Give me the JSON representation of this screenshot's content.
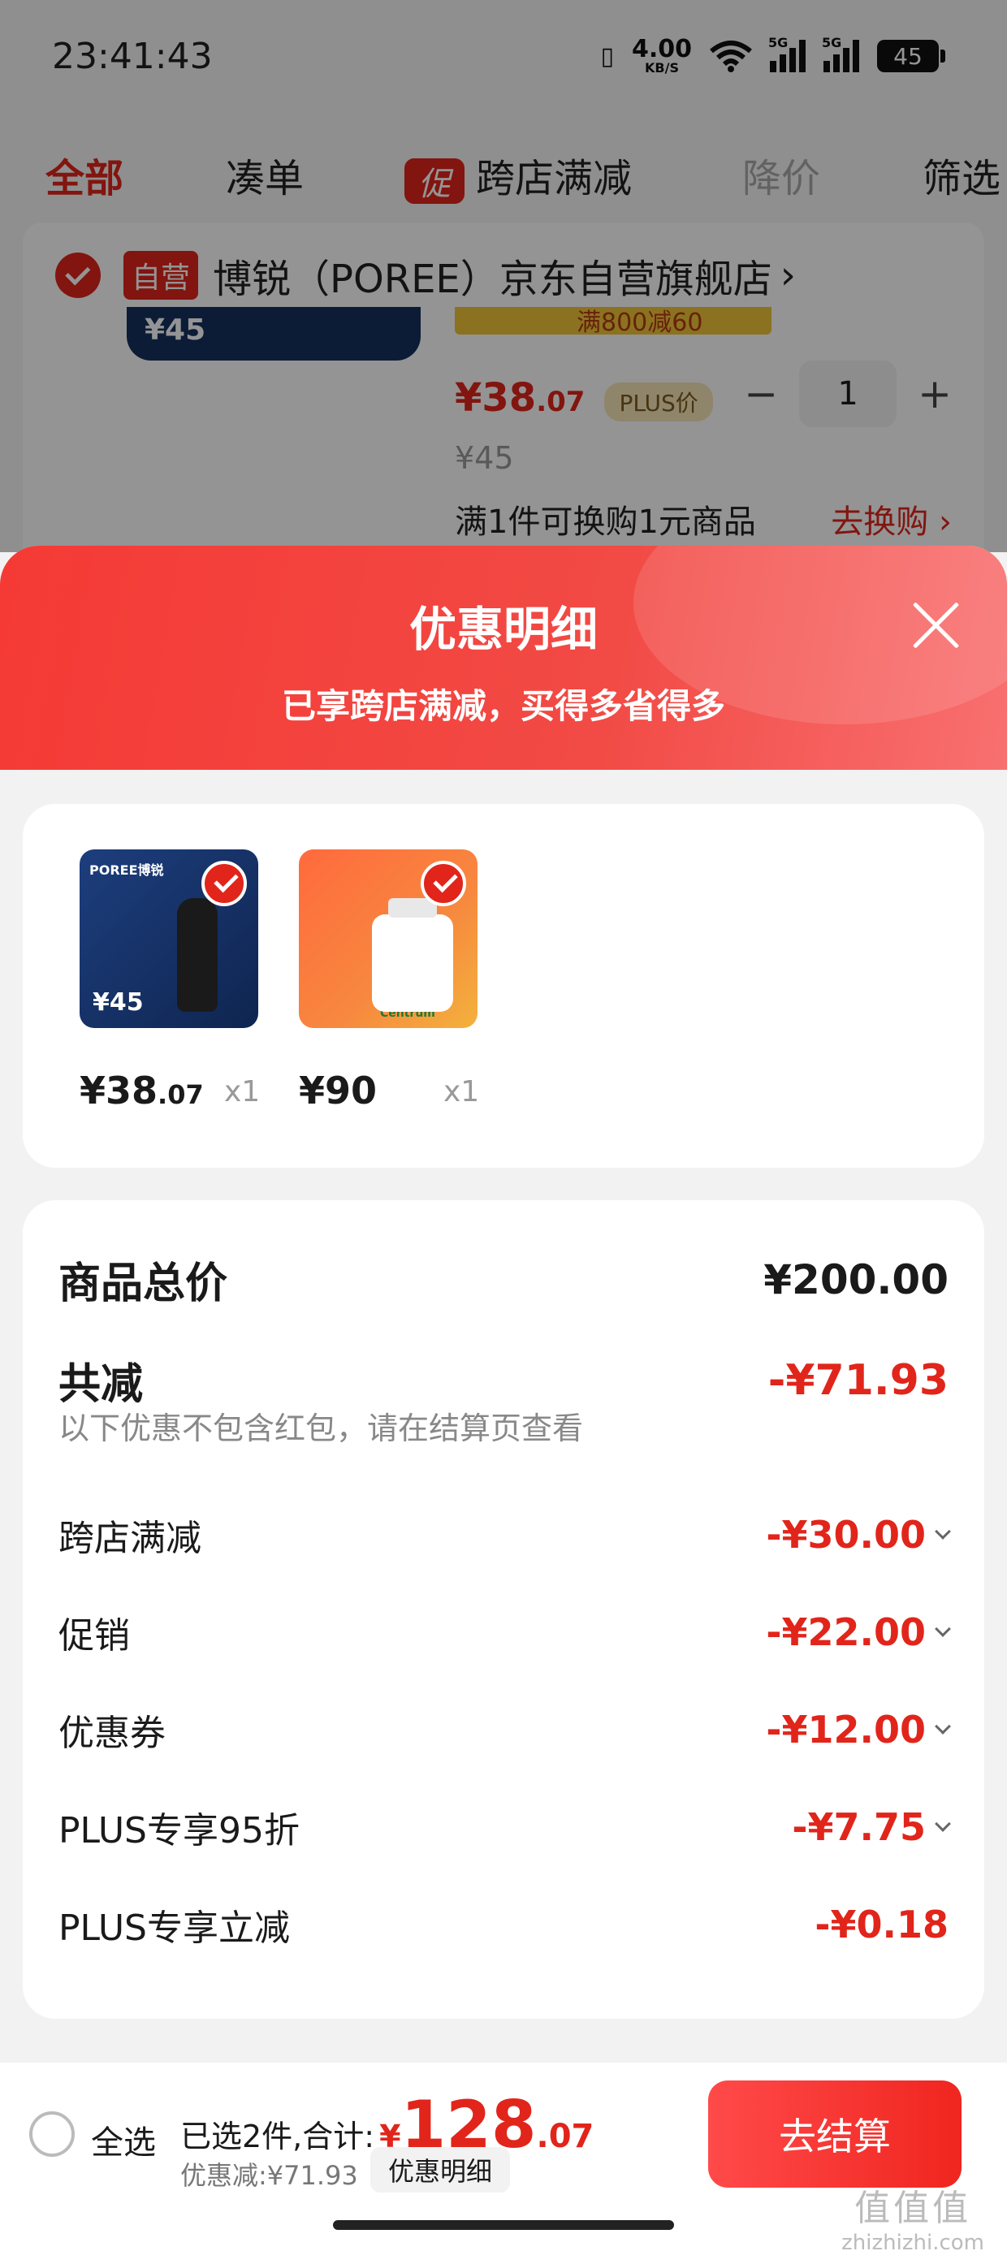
{
  "status_bar": {
    "time": "23:41:43",
    "net_speed_value": "4.00",
    "net_speed_unit": "KB/S",
    "signal1": "5G",
    "signal2": "5G",
    "battery": "45"
  },
  "tabs": [
    {
      "label": "全部",
      "active": true
    },
    {
      "label": "凑单"
    },
    {
      "label": "跨店满减",
      "badge": "促"
    },
    {
      "label": "降价"
    },
    {
      "label": "筛选"
    }
  ],
  "store": {
    "tag": "自营",
    "name": "博锐（POREE）京东自营旗舰店",
    "chevron": "›",
    "thumb_price": "¥45",
    "promo_strip": "满800减60",
    "price_symbol": "¥",
    "price_int": "38",
    "price_dec": ".07",
    "plus_tag": "PLUS价",
    "quantity": "1",
    "minus": "−",
    "plus": "+",
    "original_price": "¥45",
    "swap_text": "满1件可换购1元商品",
    "swap_link": "去换购 ›"
  },
  "sheet": {
    "title": "优惠明细",
    "subtitle": "已享跨店满减，买得多省得多",
    "products": [
      {
        "brand": "POREE博锐",
        "price_symbol": "¥",
        "price_int": "38",
        "price_dec": ".07",
        "qty": "x1",
        "thumb_price": "¥45"
      },
      {
        "brand": "Centrum",
        "price_symbol": "¥",
        "price_int": "90",
        "price_dec": "",
        "qty": "x1"
      }
    ],
    "total_label": "商品总价",
    "total_value": "¥200.00",
    "reduce_label": "共减",
    "reduce_value": "-¥71.93",
    "note": "以下优惠不包含红包，请在结算页查看",
    "items": [
      {
        "label": "跨店满减",
        "value": "-¥30.00",
        "expandable": true
      },
      {
        "label": "促销",
        "value": "-¥22.00",
        "expandable": true
      },
      {
        "label": "优惠券",
        "value": "-¥12.00",
        "expandable": true
      },
      {
        "label": "PLUS专享95折",
        "value": "-¥7.75",
        "expandable": true
      },
      {
        "label": "PLUS专享立减",
        "value": "-¥0.18",
        "expandable": false
      }
    ]
  },
  "footer": {
    "select_all": "全选",
    "selected_text": "已选2件,合计:",
    "currency": "¥",
    "total_int": "128",
    "total_dec": ".07",
    "saved_text": "优惠减:¥71.93",
    "detail_chip": "优惠明细",
    "checkout": "去结算"
  },
  "watermark": {
    "line1": "值值值",
    "line2": "zhizhizhi.com"
  },
  "colors": {
    "accent": "#e1251b",
    "header_red": "#f53a35"
  }
}
